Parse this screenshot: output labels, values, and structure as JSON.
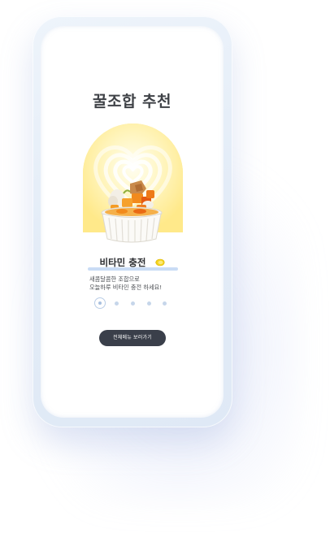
{
  "screen": {
    "title": "꿀조합 추천"
  },
  "product": {
    "name": "비타민 충전",
    "name_icon": "lemon-icon",
    "description_lines": [
      "새콤달콤한 조합으로",
      "오늘하루 비타민 충전 하세요!"
    ],
    "image": "fruit-yogurt-cup"
  },
  "pagination": {
    "total": 5,
    "active_index": 1
  },
  "cta": {
    "label": "전체메뉴 보러가기"
  },
  "colors": {
    "arch_background": "#ffe98a",
    "button_background": "#3a3f4a",
    "underline": "#c9dcf5",
    "title_text": "#3f4247"
  }
}
